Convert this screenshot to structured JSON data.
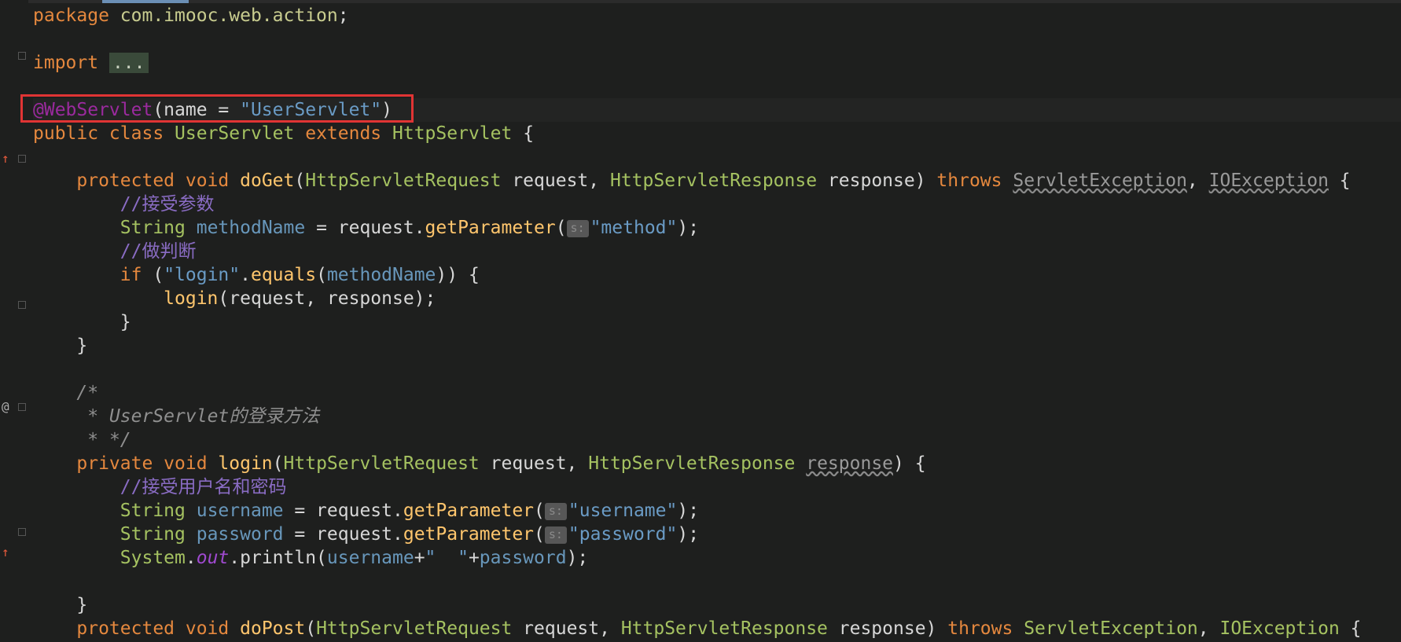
{
  "editor": {
    "language": "Java",
    "lines": [
      {
        "tokens": [
          [
            "kw",
            "package"
          ],
          [
            "plain",
            " "
          ],
          [
            "pkgname",
            "com.imooc.web.action"
          ],
          [
            "plain",
            ";"
          ]
        ]
      },
      {
        "tokens": []
      },
      {
        "tokens": [
          [
            "kw",
            "import"
          ],
          [
            "plain",
            " "
          ],
          [
            "fold",
            "..."
          ]
        ]
      },
      {
        "tokens": []
      },
      {
        "tokens": [
          [
            "ann",
            "@WebServlet"
          ],
          [
            "plain",
            "(name = "
          ],
          [
            "str",
            "\"UserServlet\""
          ],
          [
            "plain",
            ")"
          ]
        ],
        "highlight": true
      },
      {
        "tokens": [
          [
            "kw",
            "public class"
          ],
          [
            "plain",
            " "
          ],
          [
            "type",
            "UserServlet"
          ],
          [
            "plain",
            " "
          ],
          [
            "kw",
            "extends"
          ],
          [
            "plain",
            " "
          ],
          [
            "type",
            "HttpServlet"
          ],
          [
            "plain",
            " {"
          ]
        ]
      },
      {
        "tokens": []
      },
      {
        "tokens": [
          [
            "plain",
            "    "
          ],
          [
            "kw",
            "protected void"
          ],
          [
            "plain",
            " "
          ],
          [
            "method",
            "doGet"
          ],
          [
            "plain",
            "("
          ],
          [
            "type",
            "HttpServletRequest"
          ],
          [
            "plain",
            " request, "
          ],
          [
            "type",
            "HttpServletResponse"
          ],
          [
            "plain",
            " response) "
          ],
          [
            "kw",
            "throws"
          ],
          [
            "plain",
            " "
          ],
          [
            "wavy",
            "ServletException"
          ],
          [
            "plain",
            ", "
          ],
          [
            "wavy",
            "IOException"
          ],
          [
            "plain",
            " {"
          ]
        ]
      },
      {
        "tokens": [
          [
            "plain",
            "        "
          ],
          [
            "cmt",
            "//接受参数"
          ]
        ]
      },
      {
        "tokens": [
          [
            "plain",
            "        "
          ],
          [
            "type",
            "String"
          ],
          [
            "plain",
            " "
          ],
          [
            "var",
            "methodName"
          ],
          [
            "plain",
            " = request."
          ],
          [
            "method",
            "getParameter"
          ],
          [
            "plain",
            "("
          ],
          [
            "hint",
            "s:"
          ],
          [
            "str",
            "\"method\""
          ],
          [
            "plain",
            ");"
          ]
        ]
      },
      {
        "tokens": [
          [
            "plain",
            "        "
          ],
          [
            "cmt",
            "//做判断"
          ]
        ]
      },
      {
        "tokens": [
          [
            "plain",
            "        "
          ],
          [
            "kw",
            "if"
          ],
          [
            "plain",
            " ("
          ],
          [
            "str",
            "\"login\""
          ],
          [
            "plain",
            "."
          ],
          [
            "method",
            "equals"
          ],
          [
            "plain",
            "("
          ],
          [
            "var",
            "methodName"
          ],
          [
            "plain",
            ")) {"
          ]
        ]
      },
      {
        "tokens": [
          [
            "plain",
            "            "
          ],
          [
            "method",
            "login"
          ],
          [
            "plain",
            "(request, response);"
          ]
        ]
      },
      {
        "tokens": [
          [
            "plain",
            "        }"
          ]
        ]
      },
      {
        "tokens": [
          [
            "plain",
            "    }"
          ]
        ]
      },
      {
        "tokens": []
      },
      {
        "tokens": [
          [
            "plain",
            "    "
          ],
          [
            "doc",
            "/*"
          ]
        ]
      },
      {
        "tokens": [
          [
            "plain",
            "     "
          ],
          [
            "doc",
            "* UserServlet的登录方法"
          ]
        ]
      },
      {
        "tokens": [
          [
            "plain",
            "     "
          ],
          [
            "doc",
            "* */"
          ]
        ]
      },
      {
        "tokens": [
          [
            "plain",
            "    "
          ],
          [
            "kw",
            "private void"
          ],
          [
            "plain",
            " "
          ],
          [
            "method",
            "login"
          ],
          [
            "plain",
            "("
          ],
          [
            "type",
            "HttpServletRequest"
          ],
          [
            "plain",
            " request, "
          ],
          [
            "type",
            "HttpServletResponse"
          ],
          [
            "plain",
            " "
          ],
          [
            "wavy",
            "response"
          ],
          [
            "plain",
            ") {"
          ]
        ]
      },
      {
        "tokens": [
          [
            "plain",
            "        "
          ],
          [
            "cmt",
            "//接受用户名和密码"
          ]
        ]
      },
      {
        "tokens": [
          [
            "plain",
            "        "
          ],
          [
            "type",
            "String"
          ],
          [
            "plain",
            " "
          ],
          [
            "var",
            "username"
          ],
          [
            "plain",
            " = request."
          ],
          [
            "method",
            "getParameter"
          ],
          [
            "plain",
            "("
          ],
          [
            "hint",
            "s:"
          ],
          [
            "str",
            "\"username\""
          ],
          [
            "plain",
            ");"
          ]
        ]
      },
      {
        "tokens": [
          [
            "plain",
            "        "
          ],
          [
            "type",
            "String"
          ],
          [
            "plain",
            " "
          ],
          [
            "var",
            "password"
          ],
          [
            "plain",
            " = request."
          ],
          [
            "method",
            "getParameter"
          ],
          [
            "plain",
            "("
          ],
          [
            "hint",
            "s:"
          ],
          [
            "str",
            "\"password\""
          ],
          [
            "plain",
            ");"
          ]
        ]
      },
      {
        "tokens": [
          [
            "plain",
            "        "
          ],
          [
            "type",
            "System"
          ],
          [
            "plain",
            "."
          ],
          [
            "field",
            "out"
          ],
          [
            "plain",
            ".println("
          ],
          [
            "var",
            "username"
          ],
          [
            "plain",
            "+"
          ],
          [
            "str",
            "\"  \""
          ],
          [
            "plain",
            "+"
          ],
          [
            "var",
            "password"
          ],
          [
            "plain",
            ");"
          ]
        ]
      },
      {
        "tokens": []
      },
      {
        "tokens": [
          [
            "plain",
            "    }"
          ]
        ]
      },
      {
        "tokens": [
          [
            "plain",
            "    "
          ],
          [
            "kw",
            "protected void"
          ],
          [
            "plain",
            " "
          ],
          [
            "method",
            "doPost"
          ],
          [
            "plain",
            "("
          ],
          [
            "type",
            "HttpServletRequest"
          ],
          [
            "plain",
            " request, "
          ],
          [
            "type",
            "HttpServletResponse"
          ],
          [
            "plain",
            " response) "
          ],
          [
            "kw",
            "throws"
          ],
          [
            "plain",
            " "
          ],
          [
            "type",
            "ServletException"
          ],
          [
            "plain",
            ", "
          ],
          [
            "type",
            "IOException"
          ],
          [
            "plain",
            " {"
          ]
        ]
      }
    ]
  },
  "gutter_markers": {
    "override_up_icon": "↑",
    "at_icon": "@"
  },
  "colors": {
    "background": "#1e1f1e",
    "keyword": "#e5883e",
    "annotation": "#9b2a9e",
    "string": "#6a9bc5",
    "comment": "#8a6cc4",
    "method": "#ffc66d",
    "highlight_box": "#e03434"
  }
}
